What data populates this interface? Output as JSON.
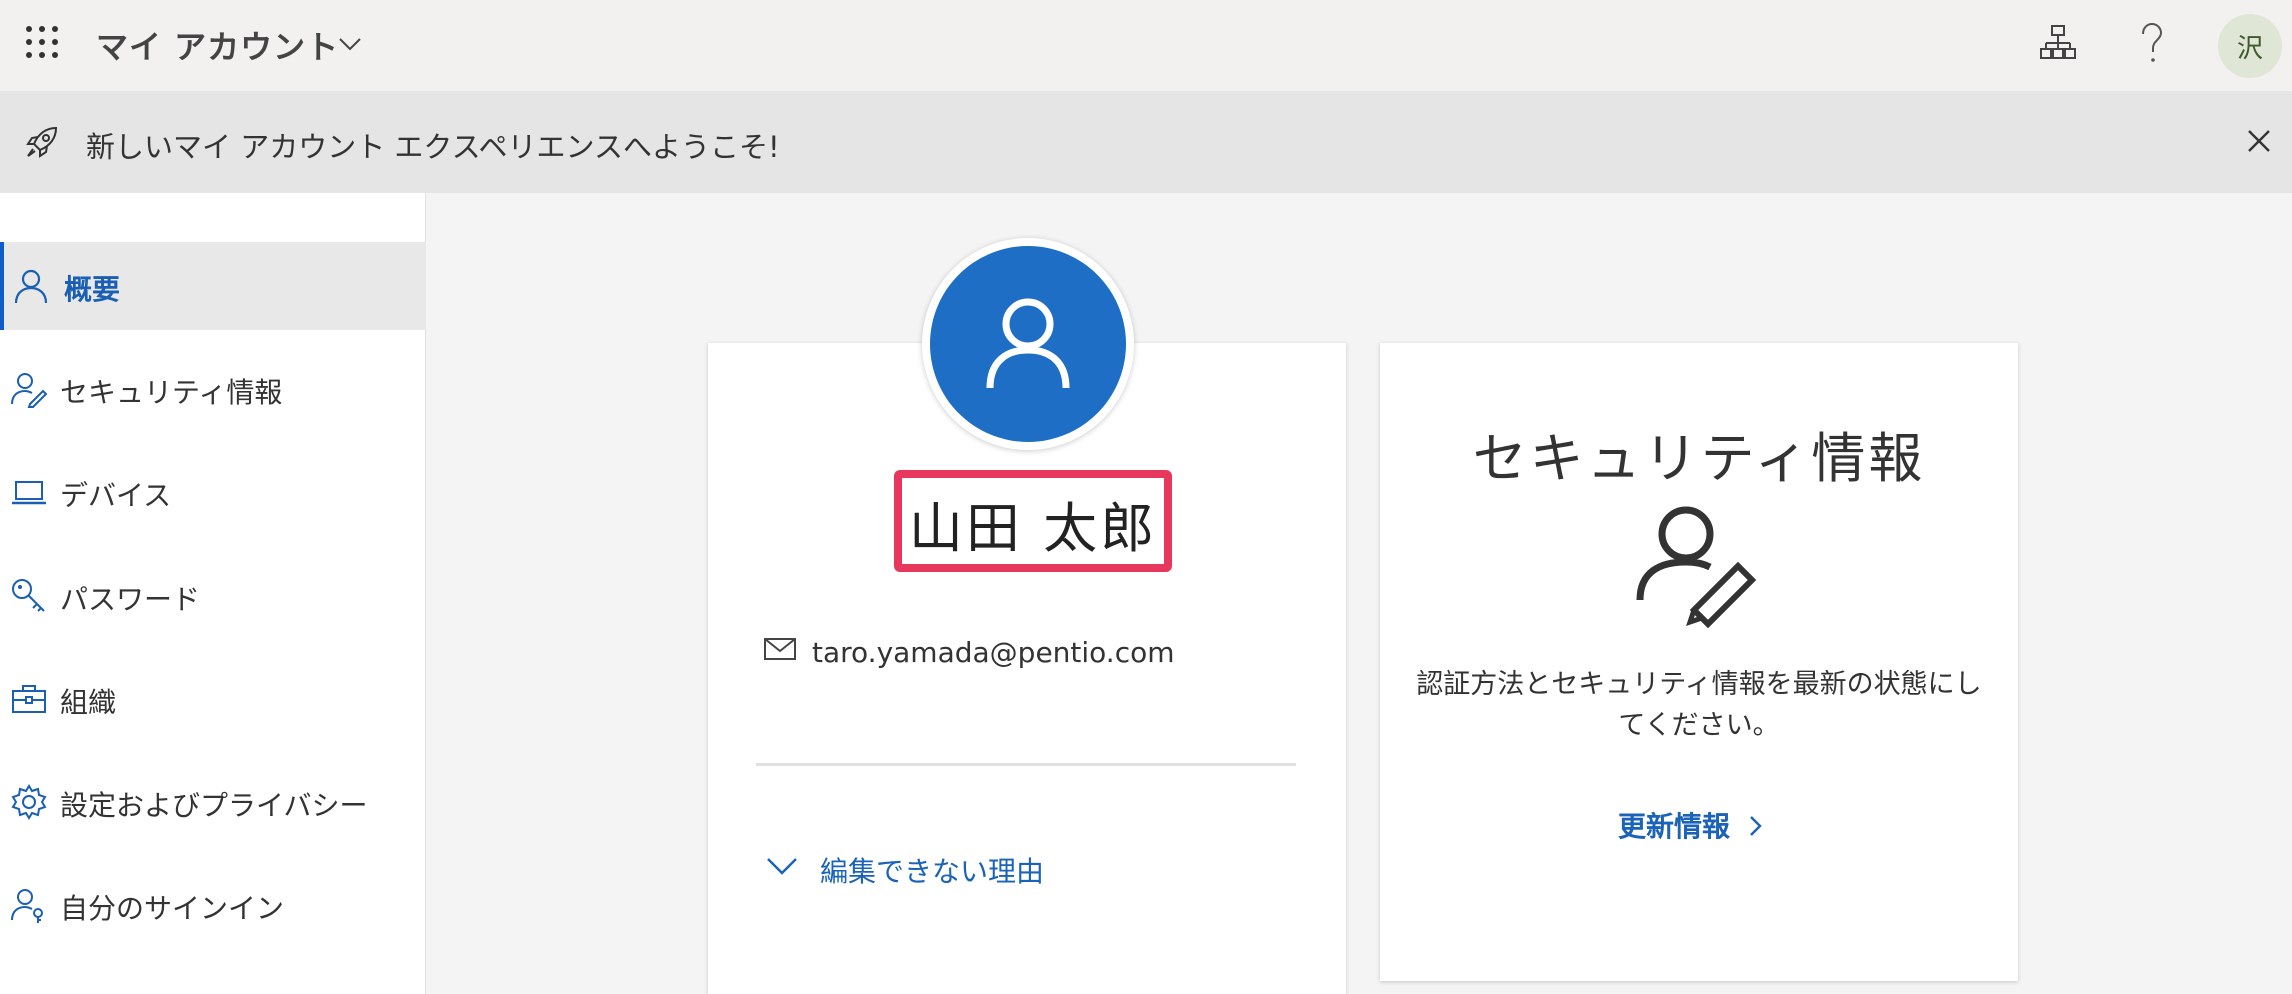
{
  "header": {
    "app_title": "マイ アカウント",
    "avatar_initial": "沢"
  },
  "banner": {
    "text": "新しいマイ アカウント エクスペリエンスへようこそ!"
  },
  "sidebar": {
    "items": [
      {
        "label": "概要",
        "icon": "person-icon",
        "active": true
      },
      {
        "label": "セキュリティ情報",
        "icon": "person-key-icon",
        "active": false
      },
      {
        "label": "デバイス",
        "icon": "laptop-icon",
        "active": false
      },
      {
        "label": "パスワード",
        "icon": "key-icon",
        "active": false
      },
      {
        "label": "組織",
        "icon": "briefcase-icon",
        "active": false
      },
      {
        "label": "設定およびプライバシー",
        "icon": "gear-icon",
        "active": false
      },
      {
        "label": "自分のサインイン",
        "icon": "person-key-icon",
        "active": false
      }
    ]
  },
  "profile": {
    "name": "山田 太郎",
    "email": "taro.yamada@pentio.com",
    "why_cannot_edit": "編集できない理由"
  },
  "security": {
    "title": "セキュリティ情報",
    "description": "認証方法とセキュリティ情報を最新の状態にしてください。",
    "update_link": "更新情報"
  },
  "colors": {
    "accent": "#1a63b8",
    "avatar_blue": "#1e6ec6",
    "highlight": "#e8375c",
    "header_bg": "#f2f1ef",
    "banner_bg": "#e5e5e5"
  }
}
